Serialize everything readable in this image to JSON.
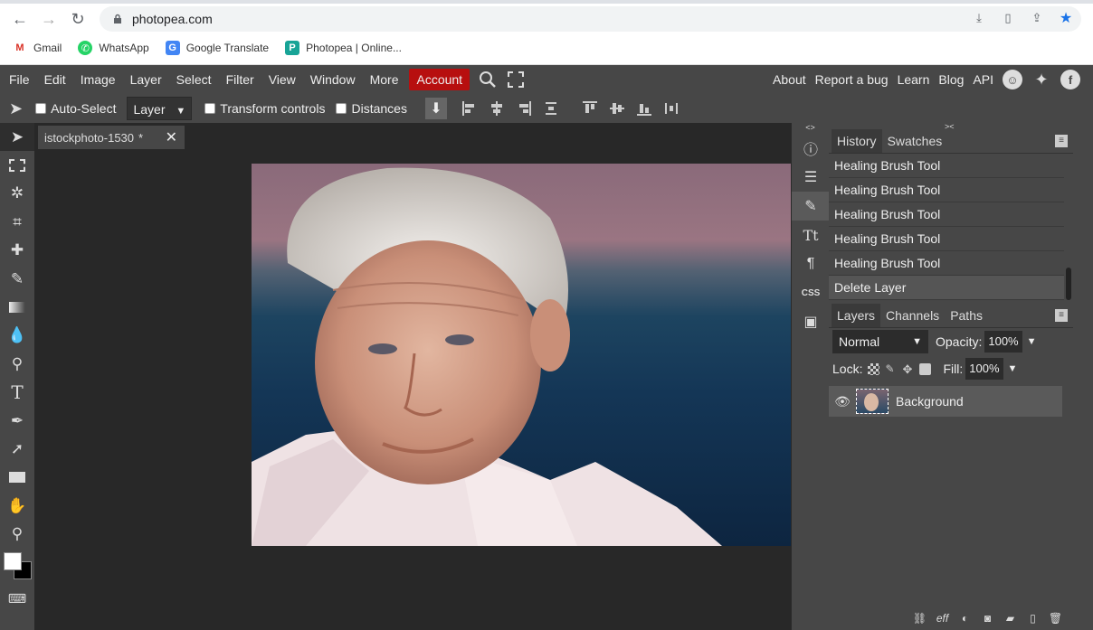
{
  "browser": {
    "url": "photopea.com",
    "bookmarks": [
      {
        "label": "Gmail",
        "icon": "gmail-icon"
      },
      {
        "label": "WhatsApp",
        "icon": "whatsapp-icon"
      },
      {
        "label": "Google Translate",
        "icon": "translate-icon"
      },
      {
        "label": "Photopea | Online...",
        "icon": "photopea-icon"
      }
    ]
  },
  "menu": {
    "items": [
      "File",
      "Edit",
      "Image",
      "Layer",
      "Select",
      "Filter",
      "View",
      "Window",
      "More"
    ],
    "account": "Account",
    "right": [
      "About",
      "Report a bug",
      "Learn",
      "Blog",
      "API"
    ]
  },
  "options": {
    "auto_select": "Auto-Select",
    "layer_select": "Layer",
    "transform_controls": "Transform controls",
    "distances": "Distances"
  },
  "document": {
    "tab_title": "istockphoto-1530",
    "tab_modified": "*"
  },
  "history": {
    "tabs": [
      "History",
      "Swatches"
    ],
    "items": [
      "Healing Brush Tool",
      "Healing Brush Tool",
      "Healing Brush Tool",
      "Healing Brush Tool",
      "Healing Brush Tool",
      "Delete Layer"
    ]
  },
  "layers": {
    "tabs": [
      "Layers",
      "Channels",
      "Paths"
    ],
    "blend_mode": "Normal",
    "opacity_label": "Opacity:",
    "opacity": "100%",
    "lock_label": "Lock:",
    "fill_label": "Fill:",
    "fill": "100%",
    "layer_name": "Background"
  },
  "colors": {
    "panel_bg": "#474747",
    "canvas_bg": "#282828",
    "account_red": "#b70f0f"
  }
}
